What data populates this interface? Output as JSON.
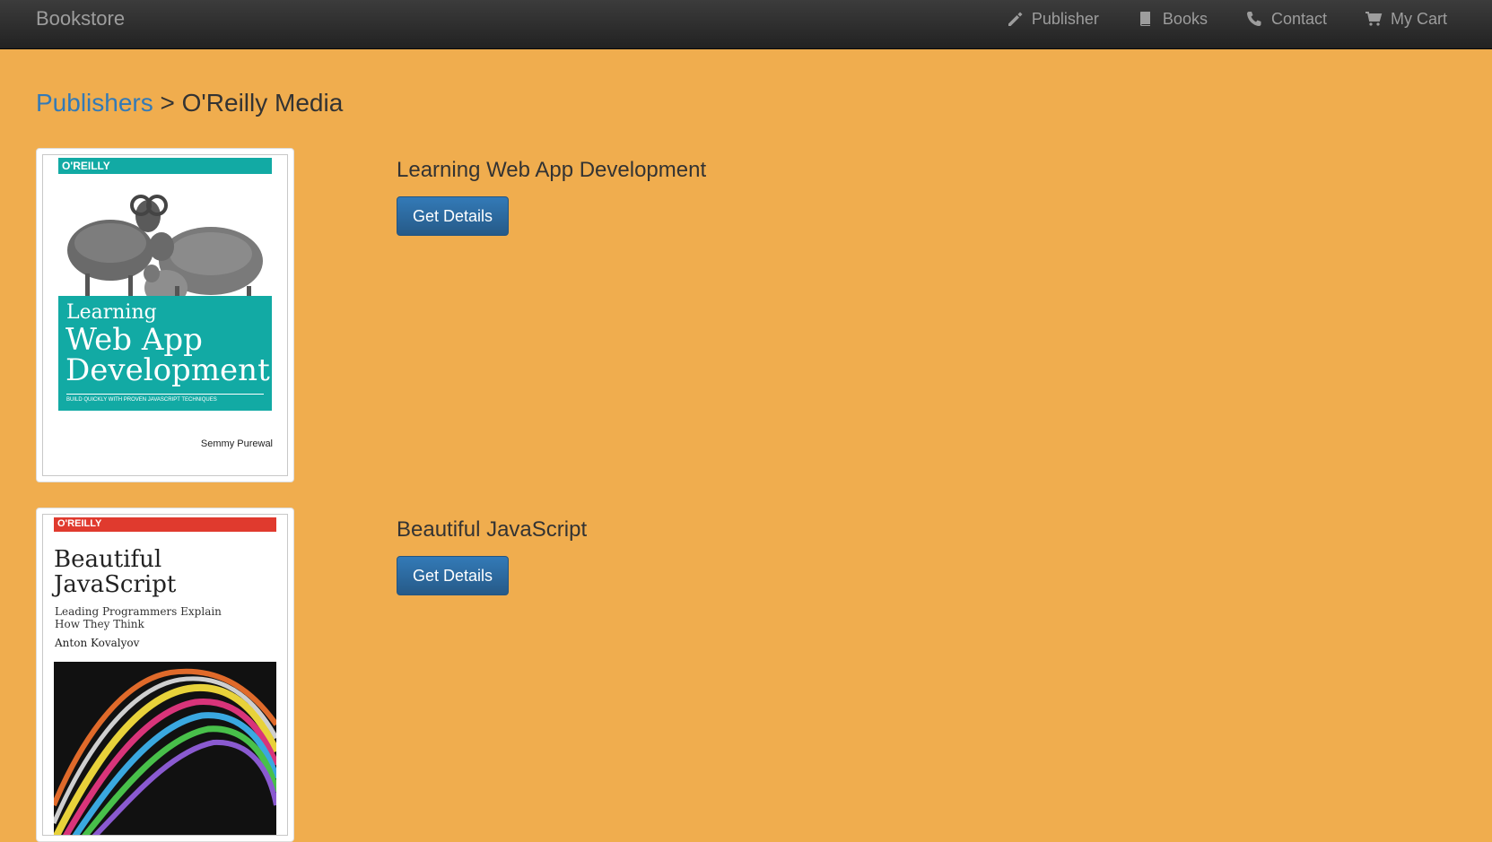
{
  "navbar": {
    "brand": "Bookstore",
    "items": [
      {
        "label": "Publisher",
        "icon": "pencil-icon"
      },
      {
        "label": "Books",
        "icon": "book-icon"
      },
      {
        "label": "Contact",
        "icon": "phone-icon"
      },
      {
        "label": "My Cart",
        "icon": "cart-icon"
      }
    ]
  },
  "breadcrumb": {
    "link": "Publishers",
    "separator": ">",
    "current": "O'Reilly Media"
  },
  "books": [
    {
      "title": "Learning Web App Development",
      "button": "Get Details",
      "cover": {
        "publisher": "O'REILLY",
        "title_line1": "Learning",
        "title_line2": "Web App",
        "title_line3": "Development",
        "tagline": "BUILD QUICKLY WITH PROVEN JAVASCRIPT TECHNIQUES",
        "author": "Semmy Purewal",
        "accent": "#12aaa4"
      }
    },
    {
      "title": "Beautiful JavaScript",
      "button": "Get Details",
      "cover": {
        "publisher": "O'REILLY",
        "title_line1": "Beautiful",
        "title_line2": "JavaScript",
        "subtitle_line1": "Leading Programmers Explain",
        "subtitle_line2": "How They Think",
        "author": "Anton Kovalyov",
        "accent": "#e03a2e"
      }
    }
  ],
  "colors": {
    "background": "#f0ad4e",
    "navbar": "#222222",
    "link": "#337ab7",
    "button": "#337ab7"
  }
}
